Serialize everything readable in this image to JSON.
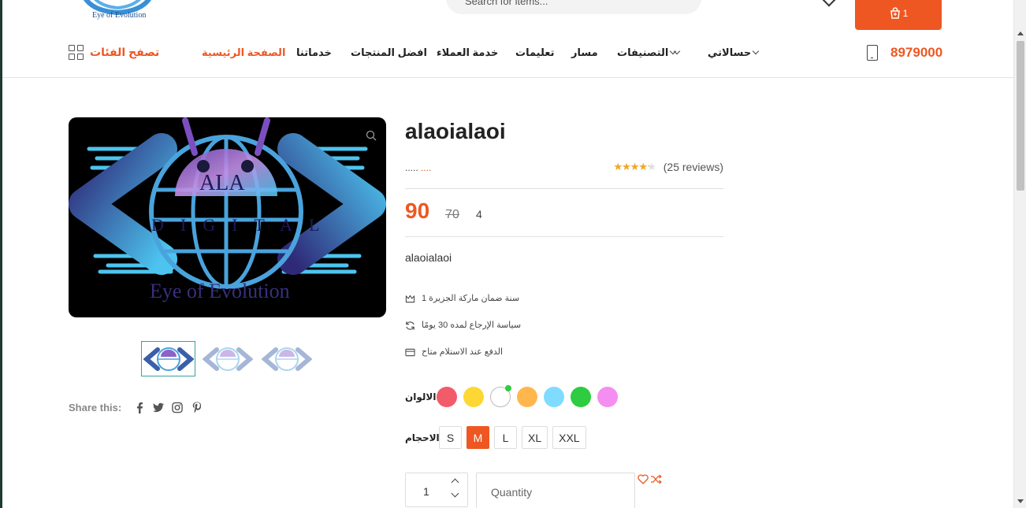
{
  "header": {
    "logo_text": "Eye of Evolution",
    "search_placeholder": "Search for items...",
    "cart_count": "1",
    "phone_number": "8979000",
    "browse_label": "تصفح الفئات"
  },
  "nav": {
    "home": "الصفحة الرئيسية",
    "services": "خدماتنا",
    "best_products": "افضل المنتجات",
    "customer_service": "خدمة العملاء",
    "instructions": "تعليمات",
    "path": "مسار",
    "categories": "التصنيفات",
    "my_account": "حسالاتي"
  },
  "product": {
    "title": "alaoialaoi",
    "brand_dots": ".....",
    "brand_value": "....",
    "rating_percent": 85,
    "reviews": "(25 reviews)",
    "price": "90",
    "old_price": "70",
    "quantity_left": "4",
    "short_description": "alaoialaoi",
    "image_text": {
      "line1": "ALA",
      "line2": "DIGITAL",
      "line3": "Eye of Evolution"
    },
    "features": [
      {
        "icon": "crown-icon",
        "text": "سنة ضمان ماركة الجزيرة 1"
      },
      {
        "icon": "refresh-icon",
        "text": "سياسة الإرجاع لمده 30 يومًا"
      },
      {
        "icon": "card-icon",
        "text": "الدفع عند الاستلام متاح"
      }
    ],
    "colors_label": "الالوان",
    "colors": [
      "#f25c6a",
      "#fdd835",
      "#ffffff",
      "#ffb74d",
      "#7fdbff",
      "#2ecc40",
      "#f48ef0"
    ],
    "selected_color_index": 2,
    "sizes_label": "الاحجام",
    "sizes": [
      "S",
      "M",
      "L",
      "XL",
      "XXL"
    ],
    "selected_size": "M",
    "quantity_value": "1",
    "quantity_placeholder": "Quantity"
  },
  "share": {
    "label": "Share this:",
    "networks": [
      "facebook-icon",
      "twitter-icon",
      "instagram-icon",
      "pinterest-icon"
    ]
  },
  "colors": {
    "accent": "#ee5722",
    "star": "#f5a623"
  }
}
